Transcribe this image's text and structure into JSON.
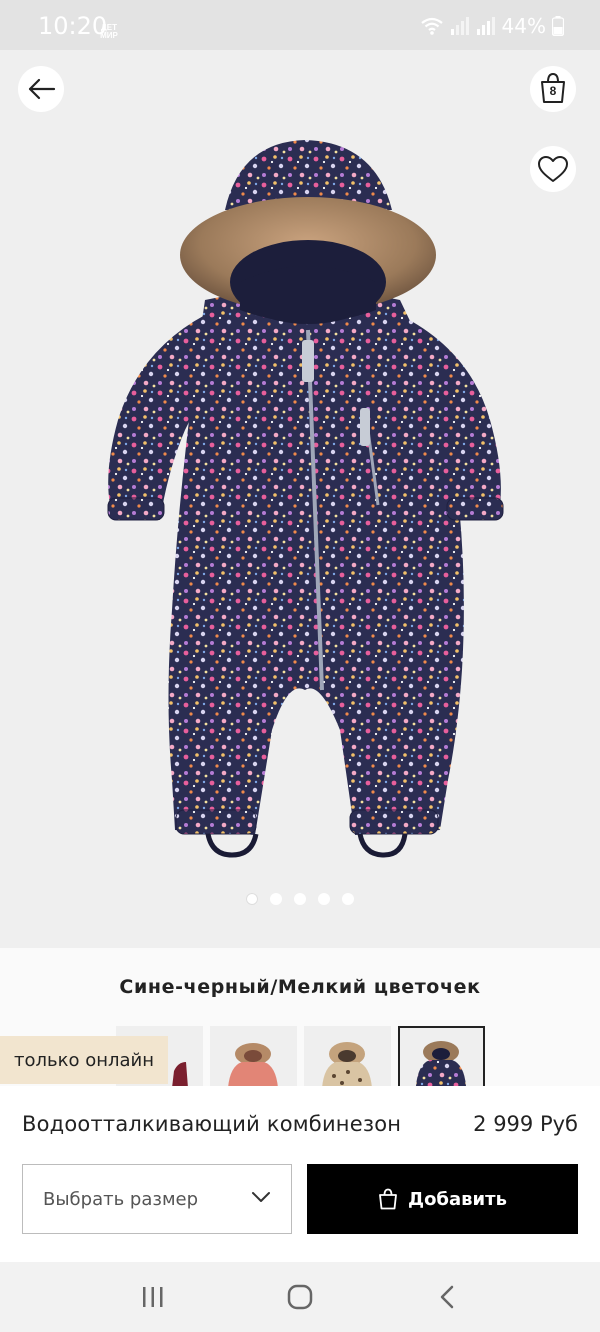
{
  "status_bar": {
    "time": "10:20",
    "app_icon_text": "ДЕТ МИР",
    "battery": "44%"
  },
  "header": {
    "bag_count": "8"
  },
  "gallery": {
    "dot_count": 5,
    "active_index": 0
  },
  "color": {
    "name": "Сине-черный/Мелкий цветочек"
  },
  "badge": {
    "online_only": "только онлайн"
  },
  "product": {
    "title": "Водоотталкивающий комбинезон",
    "price": "2 999 Руб"
  },
  "actions": {
    "size_select_label": "Выбрать размер",
    "add_label": "Добавить"
  },
  "colors": {
    "suit_base": "#2b2d52",
    "fur": "#9b7a5a",
    "accent_black": "#000000"
  }
}
